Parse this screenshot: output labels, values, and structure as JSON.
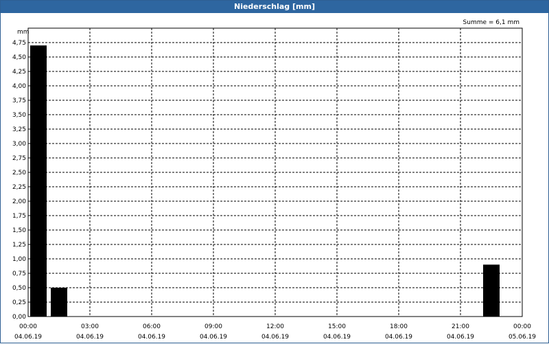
{
  "window": {
    "title": "Niederschlag [mm]"
  },
  "colors": {
    "titlebar": "#2e66a0",
    "bar": "#000000",
    "grid": "#000000"
  },
  "chart_data": {
    "type": "bar",
    "title": "Niederschlag [mm]",
    "ylabel": "mm",
    "xlabel": "",
    "summary": "Summe = 6,1 mm",
    "ylim": [
      0,
      5.0
    ],
    "xlim": [
      "2019-06-04 00:00",
      "2019-06-05 00:00"
    ],
    "grid": true,
    "y_ticks": [
      "0,00",
      "0,25",
      "0,50",
      "0,75",
      "1,00",
      "1,25",
      "1,50",
      "1,75",
      "2,00",
      "2,25",
      "2,50",
      "2,75",
      "3,00",
      "3,25",
      "3,50",
      "3,75",
      "4,00",
      "4,25",
      "4,50",
      "4,75"
    ],
    "x_ticks": [
      {
        "time": "00:00",
        "date": "04.06.19"
      },
      {
        "time": "03:00",
        "date": "04.06.19"
      },
      {
        "time": "06:00",
        "date": "04.06.19"
      },
      {
        "time": "09:00",
        "date": "04.06.19"
      },
      {
        "time": "12:00",
        "date": "04.06.19"
      },
      {
        "time": "15:00",
        "date": "04.06.19"
      },
      {
        "time": "18:00",
        "date": "04.06.19"
      },
      {
        "time": "21:00",
        "date": "04.06.19"
      },
      {
        "time": "00:00",
        "date": "05.06.19"
      }
    ],
    "bars": [
      {
        "start": "2019-06-04 00:00",
        "end": "2019-06-04 01:00",
        "value": 4.7
      },
      {
        "start": "2019-06-04 01:00",
        "end": "2019-06-04 02:00",
        "value": 0.5
      },
      {
        "start": "2019-06-04 22:00",
        "end": "2019-06-04 23:00",
        "value": 0.9
      }
    ]
  }
}
